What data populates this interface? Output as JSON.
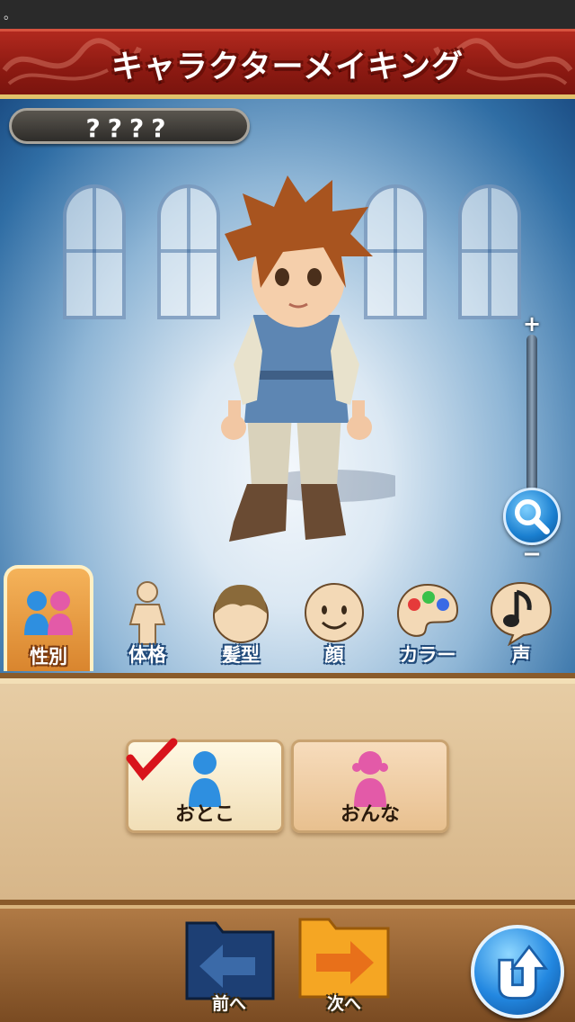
{
  "status": {
    "indicator": "。"
  },
  "header": {
    "title": "キャラクターメイキング"
  },
  "character": {
    "name": "????"
  },
  "zoom": {
    "plus_label": "+",
    "minus_label": "−"
  },
  "tabs": [
    {
      "label": "性別",
      "icon": "gender-icon",
      "active": true
    },
    {
      "label": "体格",
      "icon": "body-icon",
      "active": false
    },
    {
      "label": "髪型",
      "icon": "hair-icon",
      "active": false
    },
    {
      "label": "顔",
      "icon": "face-icon",
      "active": false
    },
    {
      "label": "カラー",
      "icon": "palette-icon",
      "active": false
    },
    {
      "label": "声",
      "icon": "music-note-icon",
      "active": false
    }
  ],
  "gender_options": [
    {
      "label": "おとこ",
      "selected": true,
      "color": "#2e8fe0"
    },
    {
      "label": "おんな",
      "selected": false,
      "color": "#e35aa8"
    }
  ],
  "footer": {
    "prev_label": "前へ",
    "next_label": "次へ"
  },
  "colors": {
    "title_bar": "#9b2016",
    "accent_blue": "#1a7fd0",
    "panel": "#e2c59b"
  }
}
